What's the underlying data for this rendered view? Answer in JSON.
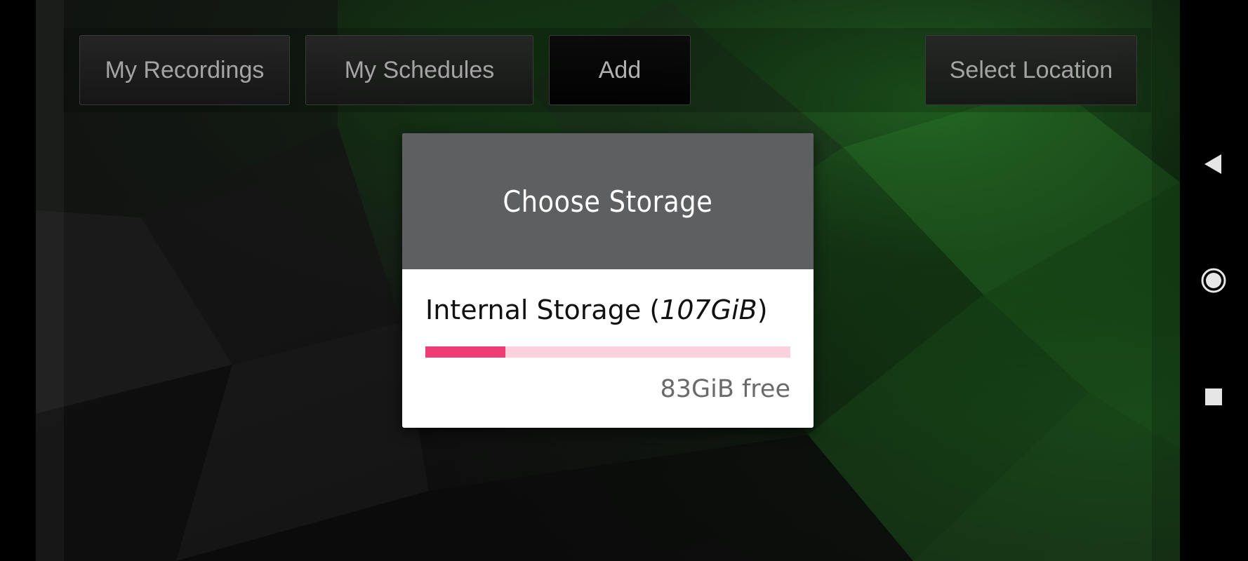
{
  "toolbar": {
    "my_recordings_label": "My Recordings",
    "my_schedules_label": "My Schedules",
    "add_label": "Add",
    "select_location_label": "Select Location"
  },
  "dialog": {
    "title": "Choose Storage",
    "storage": {
      "name": "Internal Storage",
      "size_open": "(",
      "size": "107GiB",
      "size_close": ")",
      "free_text": "83GiB free",
      "used_fraction": 0.22,
      "fill_color": "#ee3c75",
      "track_color": "#fcd0dc"
    }
  },
  "navigation": {
    "back_icon": "back-triangle-icon",
    "home_icon": "home-circle-icon",
    "recents_icon": "recents-square-icon"
  },
  "colors": {
    "dialog_header": "#5e5f60",
    "background_accent": "#1f7a1f"
  }
}
